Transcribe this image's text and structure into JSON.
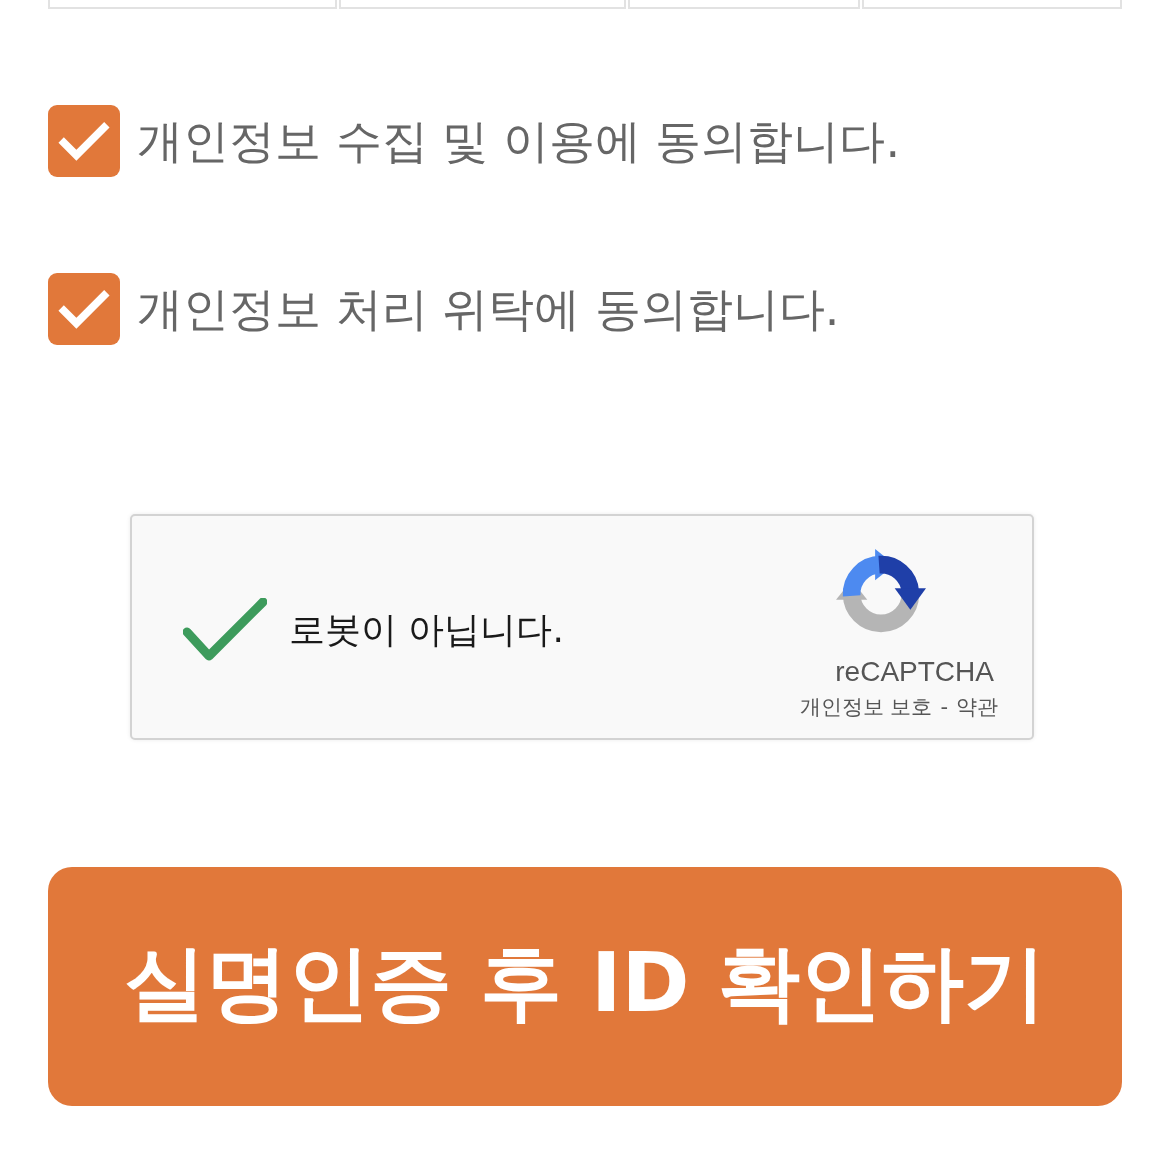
{
  "agreements": [
    {
      "label": "개인정보 수집 및 이용에 동의합니다.",
      "checked": true
    },
    {
      "label": "개인정보 처리 위탁에 동의합니다.",
      "checked": true
    }
  ],
  "captcha": {
    "label": "로봇이 아닙니다.",
    "verified": true,
    "brand": "reCAPTCHA",
    "privacy_link": "개인정보 보호",
    "separator": "-",
    "terms_link": "약관"
  },
  "submit_button": {
    "label": "실명인증 후 ID 확인하기"
  }
}
